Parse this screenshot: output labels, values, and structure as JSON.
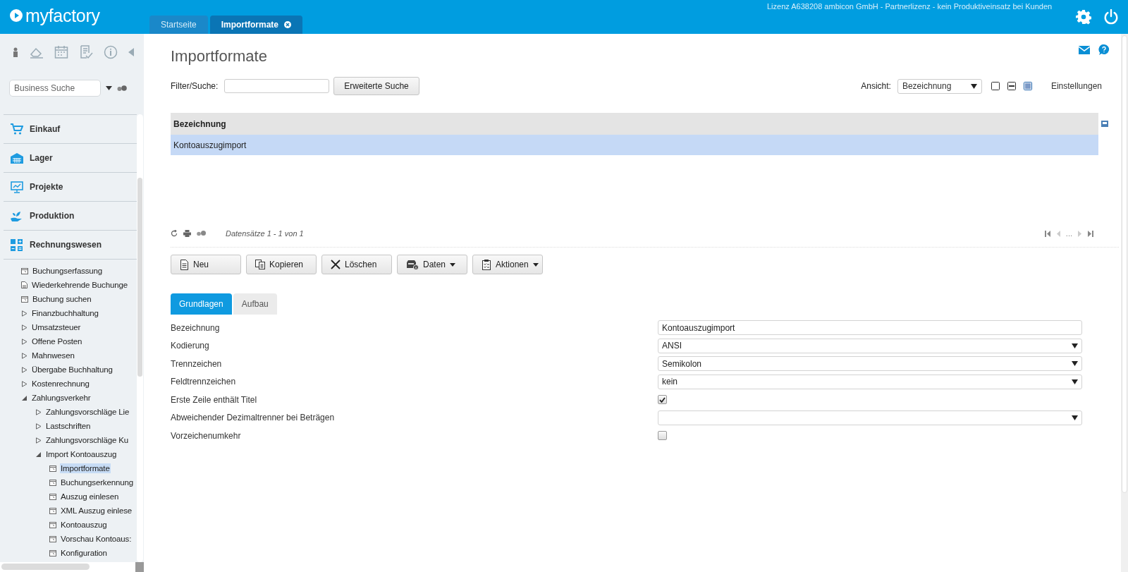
{
  "header": {
    "logo": "myfactory",
    "license": "Lizenz A638208 ambicon GmbH - Partnerlizenz - kein Produktiveinsatz bei Kunden",
    "tabs": [
      {
        "label": "Startseite",
        "selected": false,
        "closable": false
      },
      {
        "label": "Importformate",
        "selected": true,
        "closable": true
      }
    ]
  },
  "sidebar": {
    "search": {
      "placeholder": "Business Suche"
    },
    "modules": [
      {
        "label": "Einkauf"
      },
      {
        "label": "Lager"
      },
      {
        "label": "Projekte"
      },
      {
        "label": "Produktion"
      },
      {
        "label": "Rechnungswesen"
      }
    ],
    "tree": [
      {
        "label": "Buchungserfassung",
        "kind": "page",
        "selected": false
      },
      {
        "label": "Wiederkehrende Buchunge",
        "kind": "doc",
        "selected": false
      },
      {
        "label": "Buchung suchen",
        "kind": "page",
        "selected": false
      },
      {
        "label": "Finanzbuchhaltung",
        "kind": "folder",
        "expanded": false
      },
      {
        "label": "Umsatzsteuer",
        "kind": "folder",
        "expanded": false
      },
      {
        "label": "Offene Posten",
        "kind": "folder",
        "expanded": false
      },
      {
        "label": "Mahnwesen",
        "kind": "folder",
        "expanded": false
      },
      {
        "label": "Übergabe Buchhaltung",
        "kind": "folder",
        "expanded": false
      },
      {
        "label": "Kostenrechnung",
        "kind": "folder",
        "expanded": false
      },
      {
        "label": "Zahlungsverkehr",
        "kind": "folder",
        "expanded": true,
        "children": [
          {
            "label": "Zahlungsvorschläge Lie",
            "kind": "folder",
            "expanded": false
          },
          {
            "label": "Lastschriften",
            "kind": "folder",
            "expanded": false
          },
          {
            "label": "Zahlungsvorschläge Ku",
            "kind": "folder",
            "expanded": false
          },
          {
            "label": "Import Kontoauszug",
            "kind": "folder",
            "expanded": true,
            "children": [
              {
                "label": "Importformate",
                "kind": "page",
                "selected": true
              },
              {
                "label": "Buchungserkennung",
                "kind": "page",
                "selected": false
              },
              {
                "label": "Auszug einlesen",
                "kind": "page",
                "selected": false
              },
              {
                "label": "XML Auszug einlese",
                "kind": "page",
                "selected": false
              },
              {
                "label": "Kontoauszug",
                "kind": "page",
                "selected": false
              },
              {
                "label": "Vorschau Kontoaus:",
                "kind": "page",
                "selected": false
              },
              {
                "label": "Konfiguration",
                "kind": "page",
                "selected": false
              }
            ]
          }
        ]
      }
    ]
  },
  "page": {
    "title": "Importformate",
    "filter": {
      "label": "Filter/Suche:"
    },
    "advanced_search": "Erweiterte Suche",
    "view": {
      "label": "Ansicht:",
      "value": "Bezeichnung",
      "modes": [
        {
          "selected": false
        },
        {
          "selected": false
        },
        {
          "selected": true
        }
      ]
    },
    "settings": "Einstellungen",
    "table": {
      "columns": [
        "Bezeichnung"
      ],
      "rows": [
        {
          "cells": [
            "Kontoauszugimport"
          ],
          "selected": true
        }
      ]
    },
    "footer": {
      "records": "Datensätze 1 - 1 von 1",
      "pager": "..."
    },
    "actions": [
      {
        "label": "Neu",
        "dropdown": false
      },
      {
        "label": "Kopieren",
        "dropdown": false
      },
      {
        "label": "Löschen",
        "dropdown": false
      },
      {
        "label": "Daten",
        "dropdown": true
      },
      {
        "label": "Aktionen",
        "dropdown": true
      }
    ],
    "detail_tabs": [
      {
        "label": "Grundlagen",
        "selected": true
      },
      {
        "label": "Aufbau",
        "selected": false
      }
    ],
    "fields": [
      {
        "label": "Bezeichnung",
        "kind": "text",
        "value": "Kontoauszugimport"
      },
      {
        "label": "Kodierung",
        "kind": "select",
        "value": "ANSI"
      },
      {
        "label": "Trennzeichen",
        "kind": "select",
        "value": "Semikolon"
      },
      {
        "label": "Feldtrennzeichen",
        "kind": "select",
        "value": "kein"
      },
      {
        "label": "Erste Zeile enthält Titel",
        "kind": "checkbox",
        "checked": true
      },
      {
        "label": "Abweichender Dezimaltrenner bei Beträgen",
        "kind": "select"
      },
      {
        "label": "Vorzeichenumkehr",
        "kind": "checkbox",
        "checked": false
      }
    ]
  }
}
